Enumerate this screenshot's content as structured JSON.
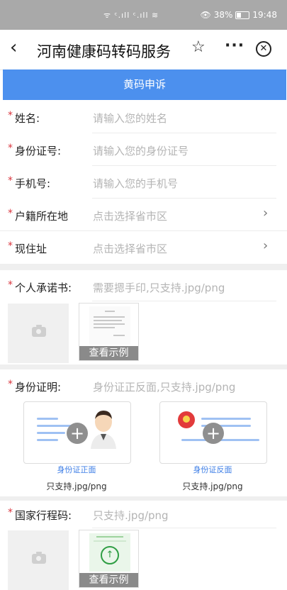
{
  "status_bar": {
    "signal_text": "ᯤ ᶜ.ıll ᶜ.ıll ≋",
    "battery_text": "38%",
    "time": "19:48",
    "eye_icon": "eye-icon"
  },
  "nav": {
    "back_icon": "‹",
    "title": "河南健康码转码服务",
    "star_icon": "☆",
    "more_icon": "···",
    "close_icon": "✕"
  },
  "banner": {
    "title": "黄码申诉"
  },
  "form": {
    "name": {
      "label": "姓名:",
      "placeholder": "请输入您的姓名"
    },
    "id_number": {
      "label": "身份证号:",
      "placeholder": "请输入您的身份证号"
    },
    "phone": {
      "label": "手机号:",
      "placeholder": "请输入您的手机号"
    },
    "hukou": {
      "label": "户籍所在地",
      "placeholder": "点击选择省市区"
    },
    "address": {
      "label": "现住址",
      "placeholder": "点击选择省市区"
    }
  },
  "commitment": {
    "label": "个人承诺书:",
    "hint": "需要摁手印,只支持.jpg/png",
    "example_label": "查看示例"
  },
  "identity": {
    "label": "身份证明:",
    "hint": "身份证正反面,只支持.jpg/png",
    "front_caption": "身份证正面",
    "back_caption": "身份证反面",
    "front_note": "只支持.jpg/png",
    "back_note": "只支持.jpg/png"
  },
  "travel_code": {
    "label": "国家行程码:",
    "hint": "只支持.jpg/png",
    "example_label": "查看示例"
  },
  "required_mark": "*"
}
